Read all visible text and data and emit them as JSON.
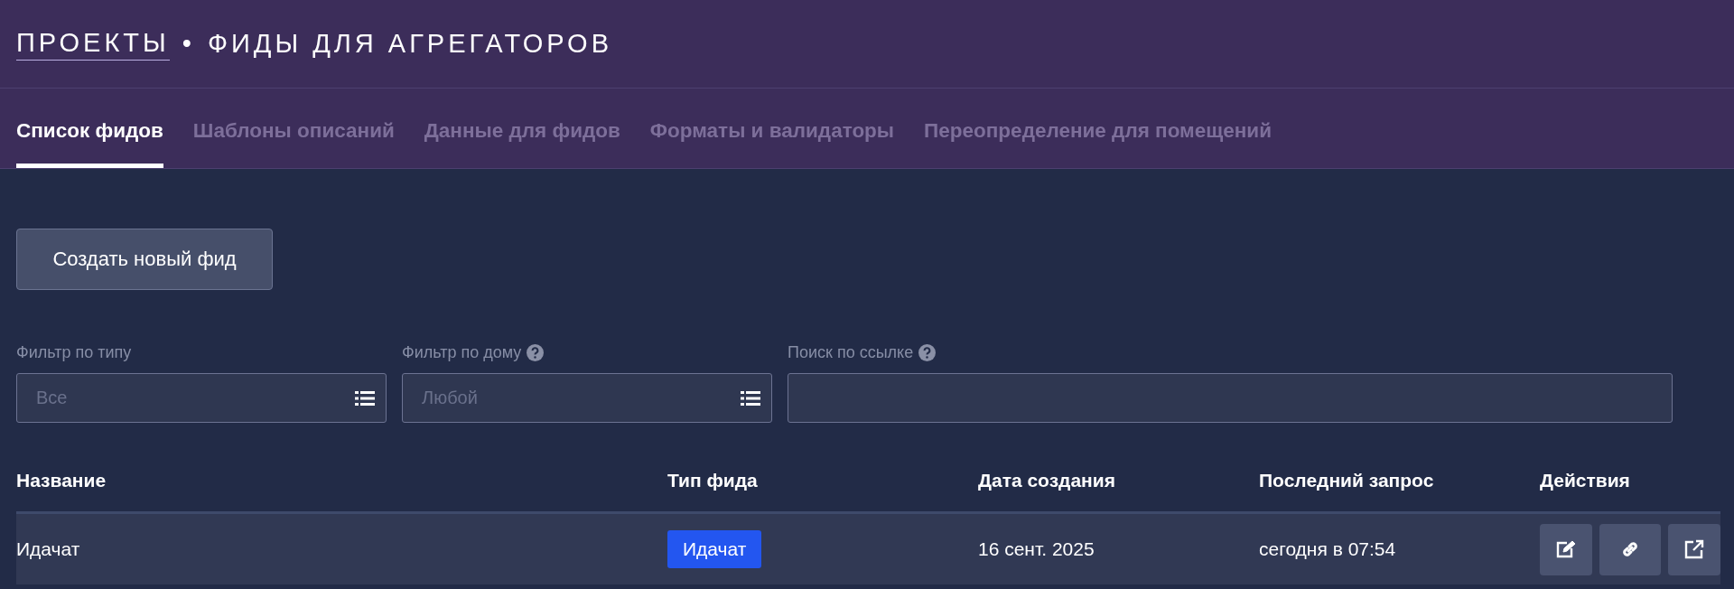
{
  "breadcrumb": {
    "parent": "ПРОЕКТЫ",
    "separator": "•",
    "current": "ФИДЫ ДЛЯ АГРЕГАТОРОВ"
  },
  "tabs": [
    {
      "label": "Список фидов",
      "selected": true
    },
    {
      "label": "Шаблоны описаний",
      "selected": false
    },
    {
      "label": "Данные для фидов",
      "selected": false
    },
    {
      "label": "Форматы и валидаторы",
      "selected": false
    },
    {
      "label": "Переопределение для помещений",
      "selected": false
    }
  ],
  "create_button": "Создать новый фид",
  "filters": [
    {
      "kind": "select",
      "label": "Фильтр по типу",
      "help": false,
      "placeholder": "Все"
    },
    {
      "kind": "select",
      "label": "Фильтр по дому",
      "help": true,
      "placeholder": "Любой"
    },
    {
      "kind": "text",
      "label": "Поиск по ссылке",
      "help": true
    }
  ],
  "table": {
    "columns": [
      "Название",
      "Тип фида",
      "Дата создания",
      "Последний запрос",
      "Действия"
    ],
    "rows": [
      {
        "name": "Идачат",
        "type": "Идачат",
        "created": "16 сент. 2025",
        "last_request": "сегодня в 07:54",
        "actions": [
          {
            "kind": "edit"
          },
          {
            "kind": "link"
          },
          {
            "kind": "external"
          }
        ]
      }
    ]
  }
}
